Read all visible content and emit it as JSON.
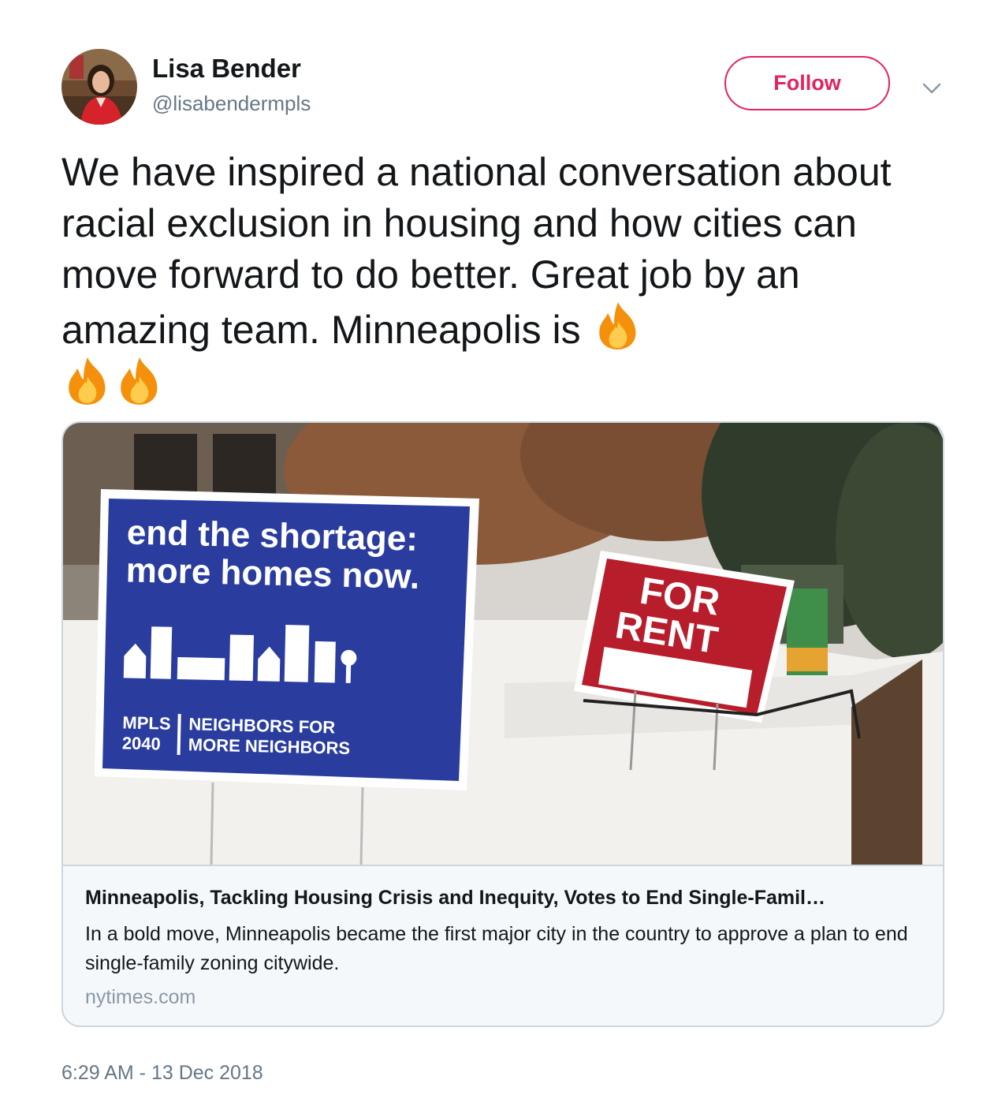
{
  "user": {
    "name": "Lisa Bender",
    "handle": "@lisabendermpls"
  },
  "follow": {
    "label": "Follow"
  },
  "tweet": {
    "text": "We have inspired a national conversation about racial exclusion in housing and how cities can move forward to do better. Great job by an amazing team. Minneapolis is",
    "emoji": "fire-emoji",
    "emoji_count": 3,
    "timestamp": "6:29 AM - 13 Dec 2018"
  },
  "card": {
    "image": {
      "sign_blue_line1": "end the shortage:",
      "sign_blue_line2": "more homes now.",
      "sign_blue_left1": "MPLS",
      "sign_blue_left2": "2040",
      "sign_blue_right1": "NEIGHBORS FOR",
      "sign_blue_right2": "MORE NEIGHBORS",
      "sign_red_line1": "FOR",
      "sign_red_line2": "RENT"
    },
    "title": "Minneapolis, Tackling Housing Crisis and Inequity, Votes to End Single-Famil…",
    "description": "In a bold move, Minneapolis became the first major city in the country to approve a plan to end single-family zoning citywide.",
    "domain": "nytimes.com"
  },
  "colors": {
    "follow_accent": "#e0245e",
    "secondary_text": "#657786",
    "sign_blue": "#2a3d9f",
    "sign_red": "#b81d2c"
  }
}
